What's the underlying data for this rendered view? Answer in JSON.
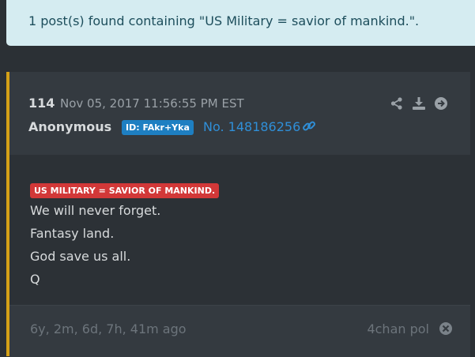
{
  "banner": {
    "text": "1 post(s) found containing \"US Military = savior of mankind.\"."
  },
  "post": {
    "number": "114",
    "date": "Nov 05, 2017 11:56:55 PM EST",
    "author": "Anonymous",
    "id_label": "ID: FAkr+Yka",
    "post_no": "No. 148186256",
    "tag": "US MILITARY = SAVIOR OF MANKIND.",
    "lines": [
      "We will never forget.",
      "Fantasy land.",
      "God save us all.",
      "Q"
    ],
    "ago": "6y, 2m, 6d, 7h, 41m ago",
    "board": "4chan pol",
    "accent_color": "#d4a017"
  },
  "icons": {
    "share": "share-icon",
    "download": "download-icon",
    "goto": "arrow-circle-right-icon",
    "link": "link-icon",
    "close": "close-circle-icon"
  }
}
